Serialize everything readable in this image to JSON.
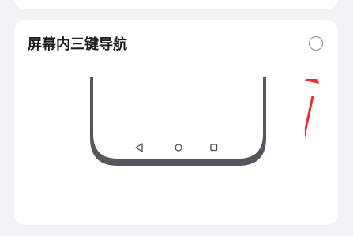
{
  "option": {
    "label": "屏幕内三键导航",
    "selected": false
  },
  "navbar_buttons": [
    "back-triangle",
    "home-circle",
    "recents-square"
  ],
  "icons": {
    "radio": "radio-unselected-icon",
    "arrow": "red-pointer-arrow-icon"
  },
  "colors": {
    "background": "#f1f2f5",
    "card": "#ffffff",
    "phone_frame": "#55575c",
    "arrow": "#ee2b2b"
  }
}
